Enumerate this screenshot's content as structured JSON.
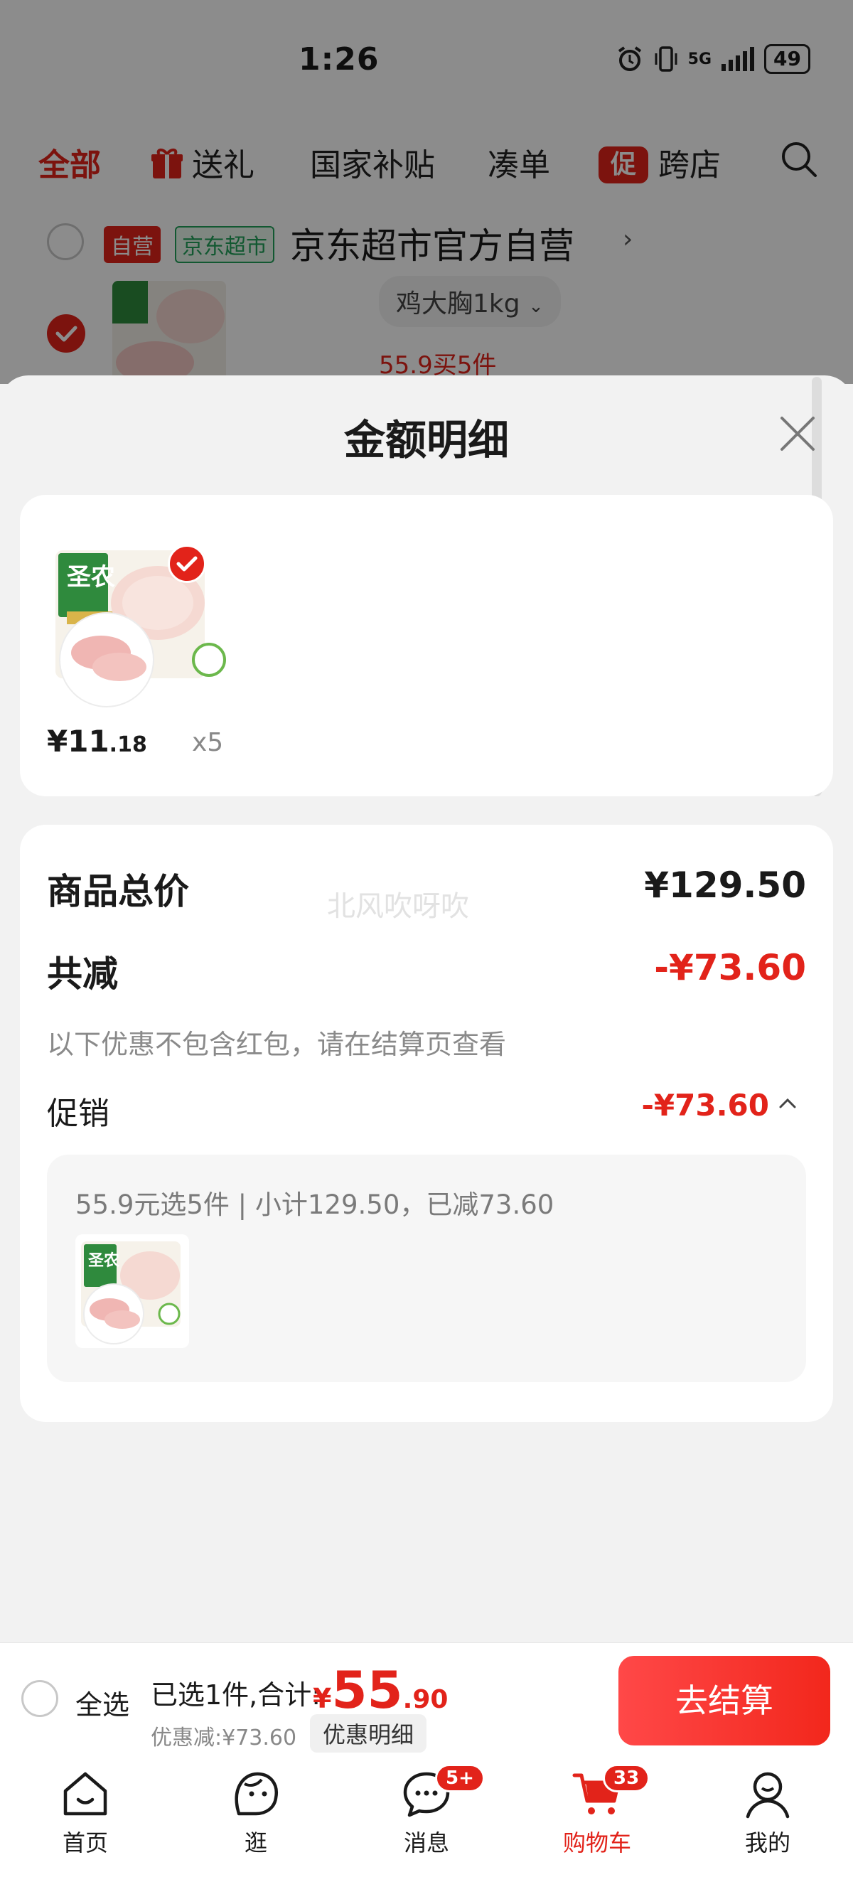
{
  "status_bar": {
    "time": "1:26",
    "network": "5G",
    "battery": "49"
  },
  "category_tabs": [
    {
      "label": "全部"
    },
    {
      "label": "送礼"
    },
    {
      "label": "国家补贴"
    },
    {
      "label": "凑单"
    },
    {
      "label": "跨店",
      "chip": "促"
    }
  ],
  "store": {
    "self_tag": "自营",
    "store_tag": "京东超市",
    "name": "京东超市官方自营",
    "spec": "鸡大胸1kg",
    "promo": "55.9买5件"
  },
  "sheet": {
    "title": "金额明细",
    "item": {
      "price_int": "¥11",
      "price_dec": ".18",
      "qty": "x5"
    },
    "summary": {
      "total_label": "商品总价",
      "total_value": "¥129.50",
      "discount_label": "共减",
      "discount_value": "-¥73.60",
      "note": "以下优惠不包含红包，请在结算页查看",
      "promo_label": "促销",
      "promo_value": "-¥73.60",
      "promo_detail": "55.9元选5件 | 小计129.50，已减73.60",
      "watermark": "北风吹呀吹"
    }
  },
  "checkout": {
    "select_all": "全选",
    "selected": "已选1件,合计:",
    "currency": "¥",
    "total_int": "55",
    "total_dec": ".90",
    "discount": "优惠减:¥73.60",
    "detail_button": "优惠明细",
    "checkout_button": "去结算"
  },
  "tab_bar": [
    {
      "label": "首页"
    },
    {
      "label": "逛"
    },
    {
      "label": "消息",
      "badge": "5+"
    },
    {
      "label": "购物车",
      "badge": "33"
    },
    {
      "label": "我的"
    }
  ],
  "colors": {
    "accent": "#e2231a",
    "store_green": "#21a05a"
  },
  "icons": [
    "gift-icon",
    "promo-chip",
    "search-icon",
    "close-icon",
    "check-icon",
    "chevron-up-icon",
    "home-icon",
    "explore-icon",
    "message-icon",
    "cart-icon",
    "profile-icon"
  ]
}
